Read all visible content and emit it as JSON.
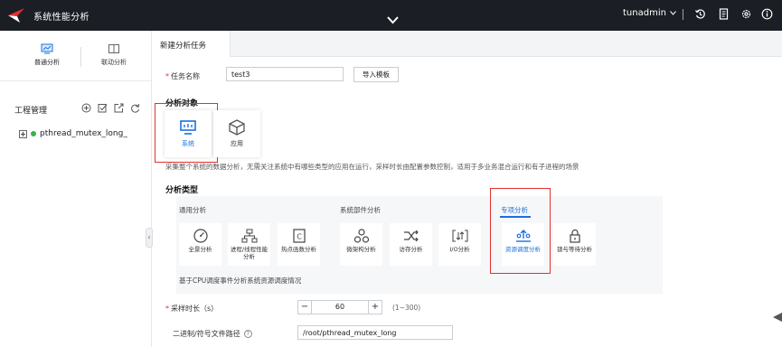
{
  "app": {
    "title": "系统性能分析"
  },
  "header": {
    "username": "tunadmin"
  },
  "sidebar": {
    "modes": [
      {
        "label": "普通分析",
        "active": true
      },
      {
        "label": "联动分析",
        "active": false
      }
    ],
    "project_header": "工程管理",
    "tree": [
      {
        "label": "pthread_mutex_long_",
        "status_color": "#37b24d"
      }
    ]
  },
  "main": {
    "tab_label": "新建分析任务",
    "task_name": {
      "label": "任务名称",
      "value": "test3"
    },
    "import_button": "导入模板",
    "target_section": {
      "title": "分析对象",
      "options": [
        {
          "label": "系统",
          "selected": true
        },
        {
          "label": "应用",
          "selected": false
        }
      ],
      "hint": "采集整个系统的数据分析，无需关注系统中有哪些类型的应用在运行，采样时长由配置参数控制，适用于多业务混合运行和有子进程的场景"
    },
    "type_section": {
      "title": "分析类型",
      "groups": {
        "general": "通用分析",
        "component": "系统部件分析",
        "special": "专项分析"
      },
      "cards": {
        "overall": "全景分析",
        "process": "进程/线程性能分析",
        "hotspot": "热点函数分析",
        "micro": "微架构分析",
        "memory": "访存分析",
        "io": "I/O分析",
        "resource": "资源调度分析",
        "lock": "锁与等待分析"
      },
      "selected": "resource",
      "description": "基于CPU调度事件分析系统资源调度情况"
    },
    "sampling": {
      "label": "采样时长（s）",
      "value": "60",
      "range": "(1~300)"
    },
    "binary_path": {
      "label": "二进制/符号文件路径",
      "value": "/root/pthread_mutex_long"
    }
  },
  "colors": {
    "accent": "#1a6fe0",
    "topbar": "#1b1e24",
    "highlight_box": "#e03131"
  }
}
